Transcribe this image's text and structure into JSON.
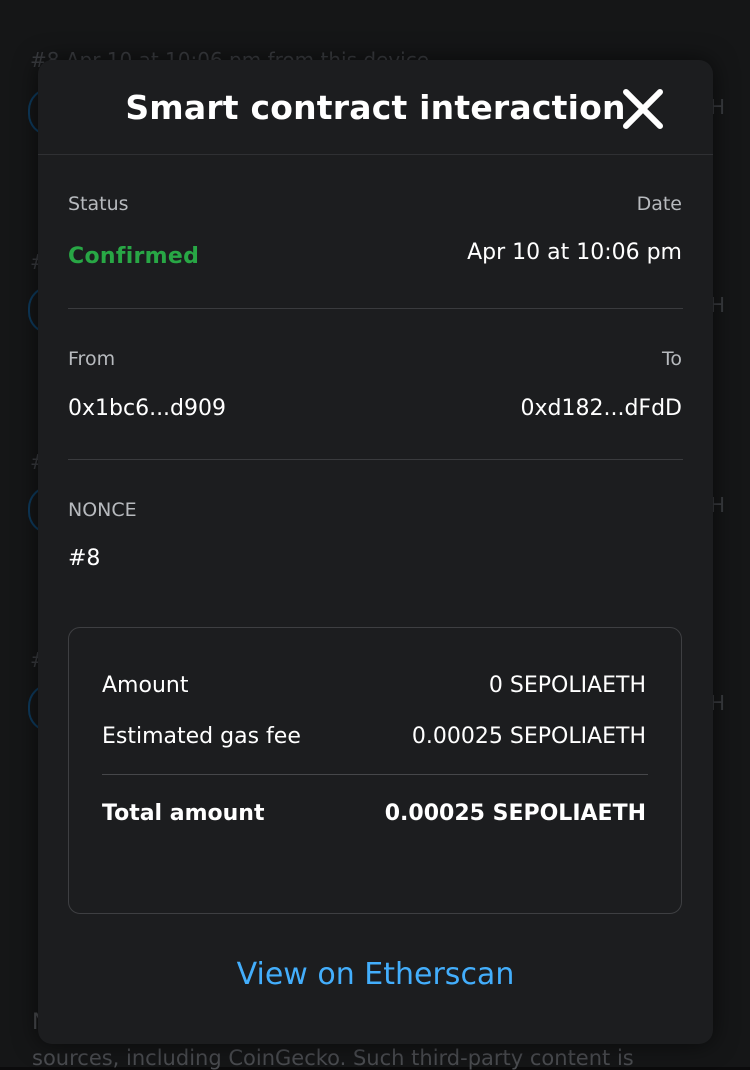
{
  "background": {
    "row_text": "#8   Apr 10 at 10:06 pm from this device",
    "bottom_text": "sources, including CoinGecko. Such third-party content is",
    "bottom_letter": "N"
  },
  "modal": {
    "title": "Smart contract interaction",
    "close_icon": "close-icon",
    "status": {
      "label": "Status",
      "value": "Confirmed",
      "color": "#28a745"
    },
    "date": {
      "label": "Date",
      "value": "Apr 10 at 10:06 pm"
    },
    "from": {
      "label": "From",
      "value": "0x1bc6...d909"
    },
    "to": {
      "label": "To",
      "value": "0xd182...dFdD"
    },
    "nonce": {
      "label": "NONCE",
      "value": "#8"
    },
    "fees": {
      "amount_label": "Amount",
      "amount_value": "0 SEPOLIAETH",
      "gas_label": "Estimated gas fee",
      "gas_value": "0.00025 SEPOLIAETH",
      "total_label": "Total amount",
      "total_value": "0.00025 SEPOLIAETH"
    },
    "link": {
      "label": "View on Etherscan",
      "color": "#43aefc"
    }
  }
}
